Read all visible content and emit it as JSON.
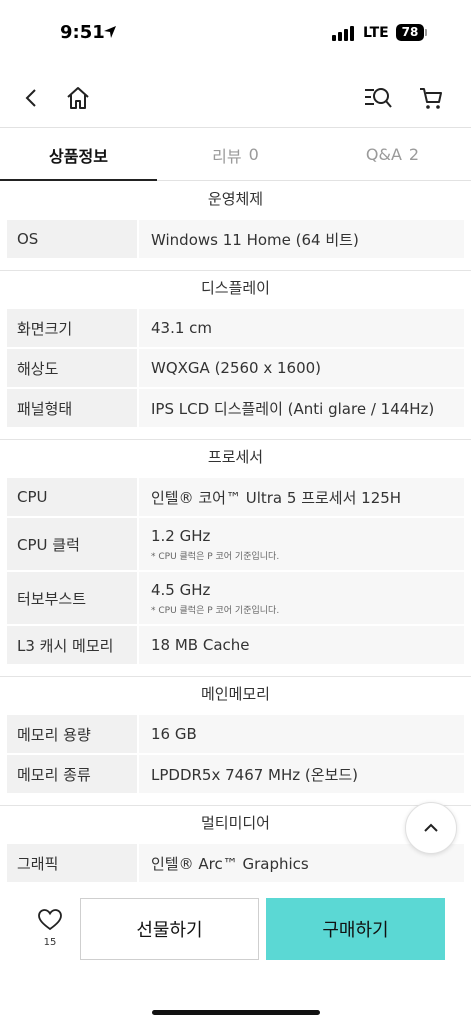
{
  "status_bar": {
    "time": "9:51",
    "network": "LTE",
    "battery": "78"
  },
  "tabs": [
    {
      "label": "상품정보",
      "count": ""
    },
    {
      "label": "리뷰",
      "count": "0"
    },
    {
      "label": "Q&A",
      "count": "2"
    }
  ],
  "specs": {
    "os": {
      "title": "운영체제",
      "rows": [
        {
          "label": "OS",
          "value": "Windows 11 Home (64 비트)"
        }
      ]
    },
    "display": {
      "title": "디스플레이",
      "rows": [
        {
          "label": "화면크기",
          "value": "43.1 cm"
        },
        {
          "label": "해상도",
          "value": "WQXGA (2560 x 1600)"
        },
        {
          "label": "패널형태",
          "value": "IPS LCD 디스플레이 (Anti glare / 144Hz)"
        }
      ]
    },
    "processor": {
      "title": "프로세서",
      "rows": [
        {
          "label": "CPU",
          "value": "인텔® 코어™ Ultra 5 프로세서 125H"
        },
        {
          "label": "CPU 클럭",
          "value": "1.2 GHz",
          "note": "* CPU 클럭은 P 코어 기준입니다."
        },
        {
          "label": "터보부스트",
          "value": "4.5 GHz",
          "note": "* CPU 클럭은 P 코어 기준입니다."
        },
        {
          "label": "L3 캐시 메모리",
          "value": "18 MB Cache"
        }
      ]
    },
    "memory": {
      "title": "메인메모리",
      "rows": [
        {
          "label": "메모리 용량",
          "value": "16 GB"
        },
        {
          "label": "메모리 종류",
          "value": "LPDDR5x 7467 MHz (온보드)"
        }
      ]
    },
    "multimedia": {
      "title": "멀티미디어",
      "rows": [
        {
          "label": "그래픽",
          "value": "인텔® Arc™ Graphics"
        }
      ]
    }
  },
  "bottom": {
    "like_count": "15",
    "gift_label": "선물하기",
    "buy_label": "구매하기"
  },
  "colors": {
    "buy_button": "#5bd8d4",
    "active_tab_underline": "#222222"
  },
  "icons": {
    "back": "back-arrow-icon",
    "home": "home-icon",
    "search": "search-list-icon",
    "cart": "cart-icon",
    "heart": "heart-icon",
    "scroll_top": "chevron-up-icon"
  }
}
